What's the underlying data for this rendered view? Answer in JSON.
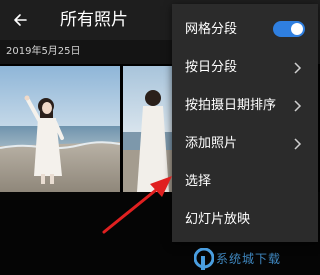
{
  "header": {
    "title": "所有照片",
    "back_icon": "back-arrow-icon"
  },
  "gallery": {
    "date_label": "2019年5月25日",
    "photos": [
      "beach-woman-photo",
      "beach-photo-partial"
    ]
  },
  "menu": {
    "items": [
      {
        "label": "网格分段",
        "control": "toggle",
        "toggle_on": true
      },
      {
        "label": "按日分段",
        "control": "chevron"
      },
      {
        "label": "按拍摄日期排序",
        "control": "chevron"
      },
      {
        "label": "添加照片",
        "control": "chevron"
      },
      {
        "label": "选择",
        "control": "none"
      },
      {
        "label": "幻灯片放映",
        "control": "none"
      }
    ]
  },
  "watermark": {
    "text": "系统城下载"
  },
  "colors": {
    "menu_background": "#2b2b2b",
    "toggle_accent": "#2f7fe0",
    "annotation_arrow": "#e02020",
    "topbar": "#1e1e1e"
  }
}
